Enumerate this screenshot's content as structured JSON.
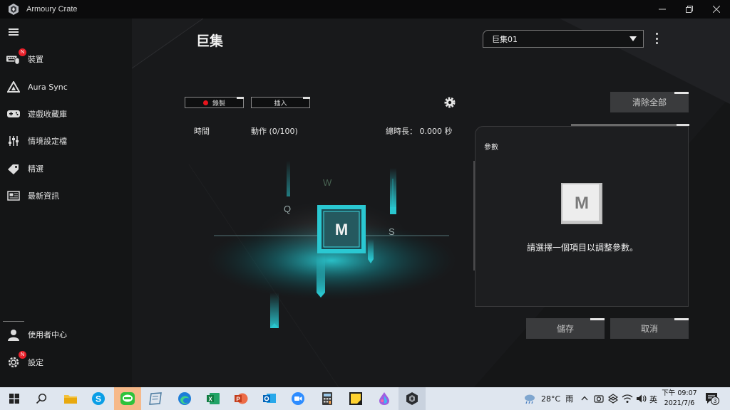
{
  "window": {
    "title": "Armoury Crate"
  },
  "sidebar": {
    "items": [
      {
        "label": "裝置",
        "icon": "keyboard-mouse-icon",
        "badge": "N"
      },
      {
        "label": "Aura Sync",
        "icon": "aura-triangle-icon"
      },
      {
        "label": "遊戲收藏庫",
        "icon": "gamepad-icon"
      },
      {
        "label": "情境設定檔",
        "icon": "sliders-icon"
      },
      {
        "label": "精選",
        "icon": "tag-icon"
      },
      {
        "label": "最新資訊",
        "icon": "news-icon"
      }
    ],
    "bottom_items": [
      {
        "label": "使用者中心",
        "icon": "user-icon"
      },
      {
        "label": "設定",
        "icon": "settings-gear-icon",
        "badge": "N"
      }
    ]
  },
  "main": {
    "title": "巨集",
    "macro_select": {
      "value": "巨集01"
    },
    "record_label": "錄製",
    "insert_label": "插入",
    "columns": {
      "time": "時間",
      "action": "動作 (0/100)",
      "total_time": "總時長： 0.000 秒"
    },
    "stage_keys": [
      "Q",
      "W",
      "S",
      "M"
    ],
    "clear_all_label": "清除全部",
    "params": {
      "title": "參數",
      "key": "M",
      "hint": "請選擇一個項目以調整參數。"
    },
    "save_label": "儲存",
    "cancel_label": "取消"
  },
  "taskbar": {
    "weather_temp": "28°C",
    "weather_desc": "雨",
    "ime": "英",
    "time": "下午 09:07",
    "date": "2021/7/6",
    "notifications": "3"
  },
  "colors": {
    "accent_cyan": "#29c6cf",
    "record_red": "#e8141c",
    "badge_red": "#e8202a"
  }
}
